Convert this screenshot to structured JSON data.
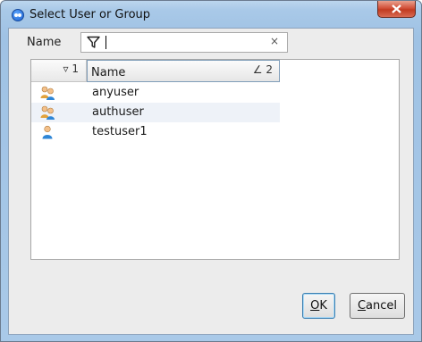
{
  "window": {
    "title": "Select User or Group",
    "close_icon": "close-icon"
  },
  "filter": {
    "label": "Name",
    "value": "",
    "clear_glyph": "×"
  },
  "table": {
    "columns": [
      {
        "label": "",
        "sort_indicator": "▿ 1"
      },
      {
        "label": "Name",
        "sort_indicator": "∠ 2"
      }
    ],
    "rows": [
      {
        "name": "anyuser",
        "icon": "user-group-icon"
      },
      {
        "name": "authuser",
        "icon": "user-group-icon"
      },
      {
        "name": "testuser1",
        "icon": "user-icon"
      }
    ]
  },
  "buttons": {
    "ok_mnemonic": "O",
    "ok_rest": "K",
    "cancel_mnemonic": "C",
    "cancel_rest": "ancel"
  }
}
